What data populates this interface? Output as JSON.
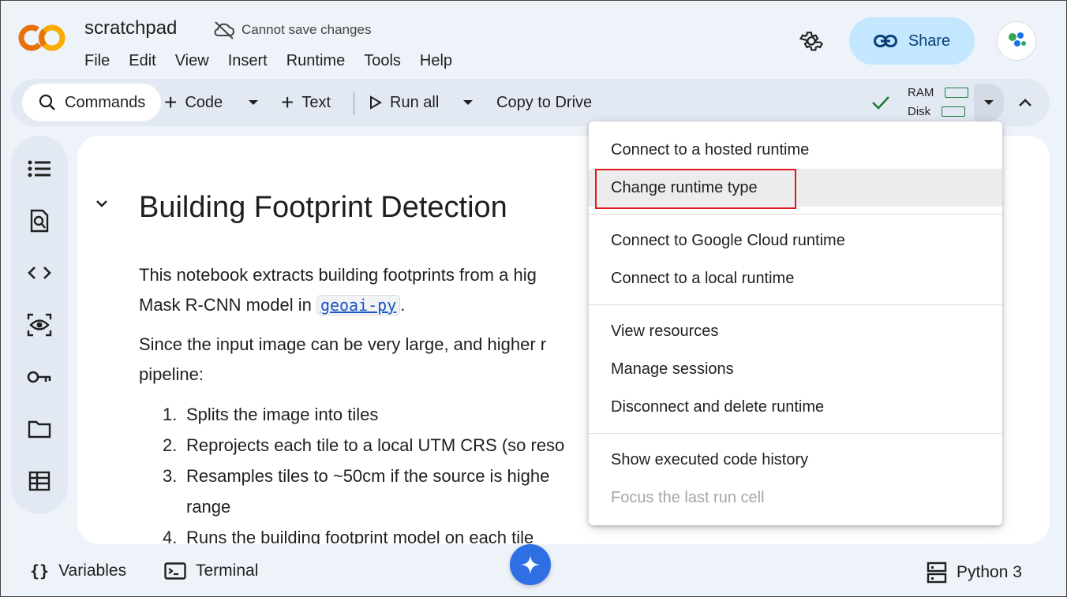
{
  "app": {
    "notebook_title": "scratchpad",
    "save_status": "Cannot save changes",
    "menus": [
      "File",
      "Edit",
      "View",
      "Insert",
      "Runtime",
      "Tools",
      "Help"
    ],
    "share_label": "Share",
    "brand_colors": {
      "logo_orange": "#f9ab00",
      "logo_dark_orange": "#e8710a",
      "share_bg": "#c2e7ff"
    }
  },
  "toolbar": {
    "commands_label": "Commands",
    "code_label": "Code",
    "text_label": "Text",
    "run_all_label": "Run all",
    "copy_to_drive_label": "Copy to Drive",
    "ram_label": "RAM",
    "disk_label": "Disk"
  },
  "sidebar": {
    "icons": [
      "table-of-contents-icon",
      "find-icon",
      "code-snippets-icon",
      "inspect-icon",
      "secrets-key-icon",
      "files-folder-icon",
      "data-table-icon"
    ]
  },
  "notebook": {
    "heading": "Building Footprint Detection",
    "para1_line1": "This notebook extracts building footprints from a hig",
    "para1_line2_prefix": "Mask R-CNN model in ",
    "para1_code": "geoai-py",
    "para1_line2_suffix": ".",
    "para2_line1": "Since the input image can be very large, and higher r",
    "para2_line2": "pipeline:",
    "steps": [
      {
        "num": "1.",
        "text": "Splits the image into tiles"
      },
      {
        "num": "2.",
        "text": "Reprojects each tile to a local UTM CRS (so reso"
      },
      {
        "num": "3.",
        "text": "Resamples tiles to ~50cm if the source is highe"
      },
      {
        "num": "",
        "text": "range"
      },
      {
        "num": "4.",
        "text": "Runs the building footprint model on each tile"
      }
    ]
  },
  "runtime_menu": {
    "items": [
      {
        "label": "Connect to a hosted runtime",
        "state": "normal"
      },
      {
        "label": "Change runtime type",
        "state": "highlighted"
      },
      {
        "label": "Connect to Google Cloud runtime",
        "state": "normal"
      },
      {
        "label": "Connect to a local runtime",
        "state": "normal"
      },
      {
        "label": "View resources",
        "state": "normal"
      },
      {
        "label": "Manage sessions",
        "state": "normal"
      },
      {
        "label": "Disconnect and delete runtime",
        "state": "normal"
      },
      {
        "label": "Show executed code history",
        "state": "normal"
      },
      {
        "label": "Focus the last run cell",
        "state": "disabled"
      }
    ],
    "highlight_color": "#e0161d"
  },
  "bottom_bar": {
    "variables_label": "Variables",
    "terminal_label": "Terminal",
    "python_label": "Python 3"
  }
}
